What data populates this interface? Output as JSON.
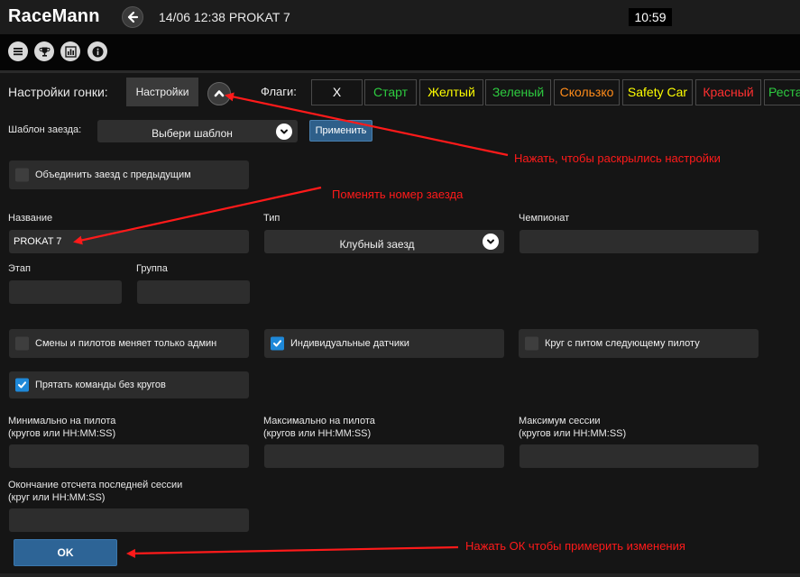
{
  "header": {
    "logo": "RaceMann",
    "session_title": "14/06 12:38 PROKAT 7",
    "clock": "10:59"
  },
  "toolbar": {
    "icons": [
      "menu-icon",
      "trophy-icon",
      "chart-icon",
      "info-icon"
    ]
  },
  "settings_row": {
    "label": "Настройки гонки:",
    "button": "Настройки",
    "flags_label": "Флаги:"
  },
  "flags": [
    {
      "label": "X",
      "color": "#ffffff"
    },
    {
      "label": "Старт",
      "color": "#2ecc40"
    },
    {
      "label": "Желтый",
      "color": "#ffff00"
    },
    {
      "label": "Зеленый",
      "color": "#2ecc40"
    },
    {
      "label": "Скользко",
      "color": "#ff8c1a"
    },
    {
      "label": "Safety Car",
      "color": "#ffff00"
    },
    {
      "label": "Красный",
      "color": "#ff3030"
    },
    {
      "label": "Реста",
      "color": "#2ecc40"
    }
  ],
  "template": {
    "label": "Шаблон заезда:",
    "placeholder": "Выбери шаблон",
    "apply": "Применить"
  },
  "merge": {
    "label": "Объединить заезд с предыдущим",
    "checked": false
  },
  "fields": {
    "name_label": "Название",
    "name_value": "PROKAT 7",
    "type_label": "Тип",
    "type_value": "Клубный заезд",
    "championship_label": "Чемпионат",
    "championship_value": "",
    "stage_label": "Этап",
    "stage_value": "",
    "group_label": "Группа",
    "group_value": ""
  },
  "options": {
    "admin_only": {
      "label": "Смены и пилотов меняет только админ",
      "checked": false
    },
    "individual_sensors": {
      "label": "Индивидуальные датчики",
      "checked": true
    },
    "pit_lap": {
      "label": "Круг с питом следующему пилоту",
      "checked": false
    },
    "hide_teams": {
      "label": "Прятать команды без кругов",
      "checked": true
    }
  },
  "limits": {
    "min_label_1": "Минимально на пилота",
    "min_label_2": "(кругов или HH:MM:SS)",
    "min_value": "",
    "max_label_1": "Максимально на пилота",
    "max_label_2": "(кругов или HH:MM:SS)",
    "max_value": "",
    "max_session_label_1": "Максимум сессии",
    "max_session_label_2": "(кругов или HH:MM:SS)",
    "max_session_value": "",
    "end_label_1": "Окончание отсчета последней сессии",
    "end_label_2": "(круг или HH:MM:SS)",
    "end_value": ""
  },
  "ok_button": "OK",
  "annotations": {
    "open_settings": "Нажать, чтобы раскрылись настройки",
    "change_number": "Поменять номер заезда",
    "press_ok": "Нажать ОК чтобы примерить изменения",
    "color": "#ff1a1a"
  }
}
